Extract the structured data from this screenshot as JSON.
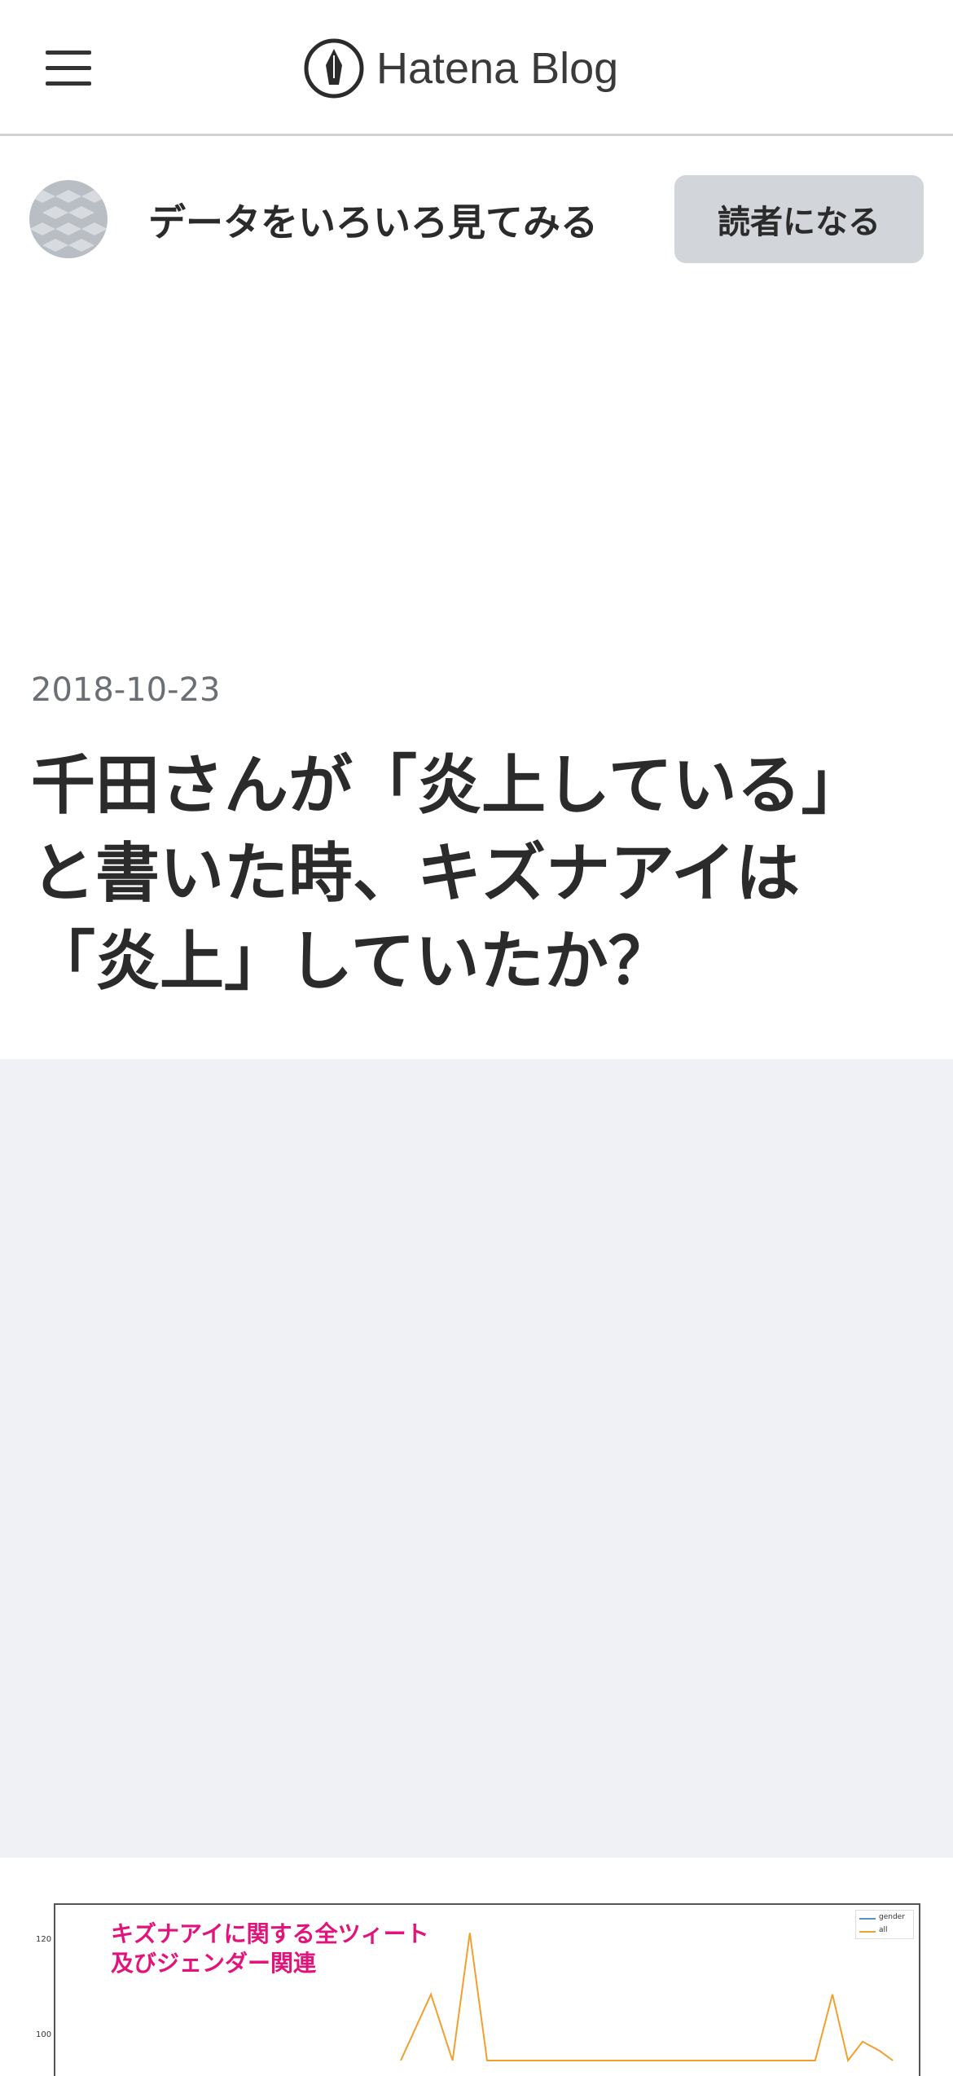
{
  "topbar": {
    "logo_text": "Hatena Blog"
  },
  "blog": {
    "title": "データをいろいろ見てみる",
    "subscribe_label": "読者になる"
  },
  "entry": {
    "date": "2018-10-23",
    "title": "千田さんが「炎上している」と書いた時、キズナアイは「炎上」していたか？"
  },
  "colors": {
    "accent_caption": "#e0147a",
    "series_all": "#f0a030",
    "series_gender": "#5b8fc7",
    "ad_background": "#eff1f5"
  },
  "chart_data": {
    "type": "line",
    "caption_lines": [
      "キズナアイに関する全ツィート",
      "及びジェンダー関連"
    ],
    "yticks": [
      "120",
      "100"
    ],
    "legend": [
      "gender",
      "all"
    ],
    "series": [
      {
        "name": "all",
        "points": [
          [
            0.4,
            95
          ],
          [
            0.435,
            109
          ],
          [
            0.46,
            95
          ],
          [
            0.48,
            122
          ],
          [
            0.5,
            95
          ],
          [
            0.88,
            95
          ],
          [
            0.9,
            109
          ],
          [
            0.918,
            95
          ],
          [
            0.935,
            99
          ],
          [
            0.955,
            97
          ],
          [
            0.97,
            95
          ]
        ]
      },
      {
        "name": "gender",
        "points": []
      }
    ],
    "ylim": [
      95,
      125
    ]
  }
}
